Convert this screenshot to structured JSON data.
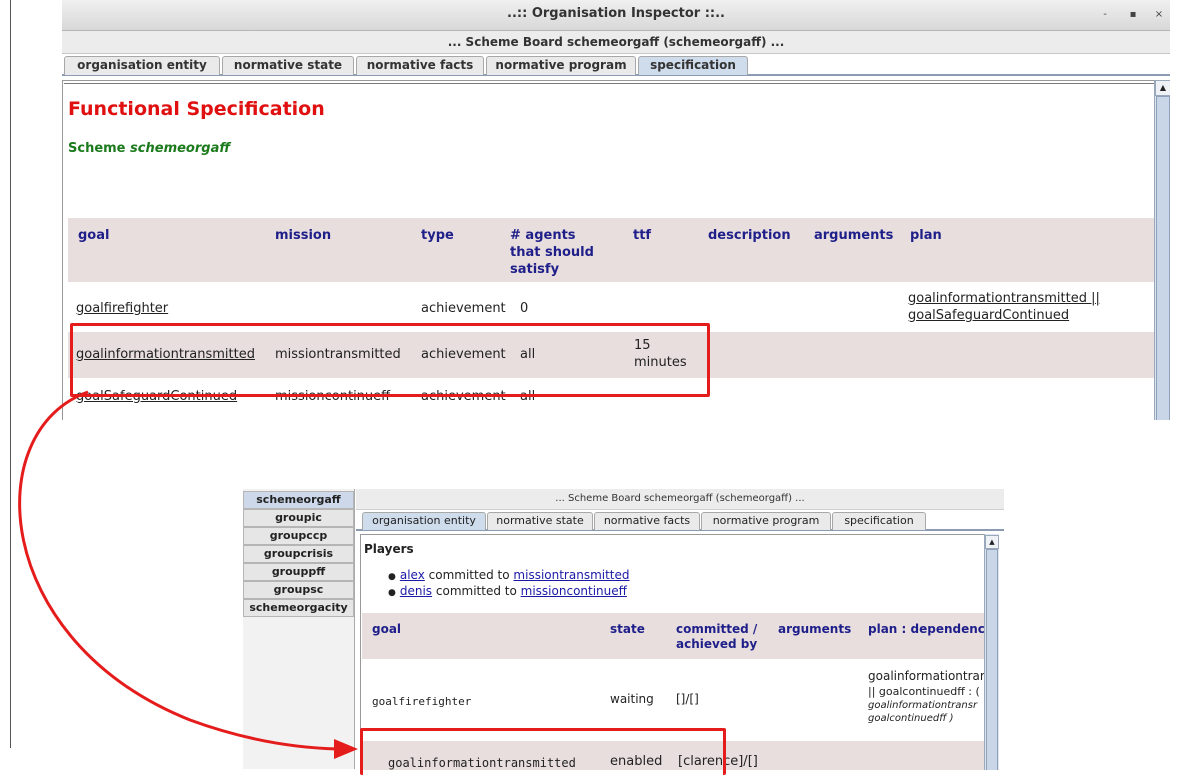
{
  "top_window": {
    "title": "..:: Organisation Inspector ::..",
    "controls": [
      "-",
      "▪",
      "×"
    ],
    "subtitle": "... Scheme Board schemeorgaff (schemeorgaff) ...",
    "tabs": [
      "organisation entity",
      "normative state",
      "normative facts",
      "normative program",
      "specification"
    ],
    "selected_tab": "specification",
    "heading": "Functional Specification",
    "scheme_prefix": "Scheme",
    "scheme_name": "schemeorgaff",
    "table": {
      "headers": {
        "goal": "goal",
        "mission": "mission",
        "type": "type",
        "agents": "# agents that should satisfy",
        "ttf": "ttf",
        "description": "description",
        "arguments": "arguments",
        "plan": "plan"
      },
      "rows": [
        {
          "goal": "goalfirefighter",
          "mission": "",
          "type": "achievement",
          "agents": "0",
          "ttf": "",
          "plan_a": "goalinformationtransmitted ||",
          "plan_b": "goalSafeguardContinued"
        },
        {
          "goal": "goalinformationtransmitted",
          "mission": "missiontransmitted",
          "type": "achievement",
          "agents": "all",
          "ttf": "15 minutes"
        },
        {
          "goal": "goalSafeguardContinued",
          "mission": "missioncontinueff",
          "type": "achievement",
          "agents": "all"
        }
      ]
    }
  },
  "bottom_window": {
    "side_list": [
      "schemeorgaff",
      "groupic",
      "groupccp",
      "groupcrisis",
      "grouppff",
      "groupsc",
      "schemeorgacity"
    ],
    "selected_side": "schemeorgaff",
    "subtitle": "... Scheme Board schemeorgaff (schemeorgaff) ...",
    "tabs": [
      "organisation entity",
      "normative state",
      "normative facts",
      "normative program",
      "specification"
    ],
    "selected_tab": "organisation entity",
    "players_label": "Players",
    "players": [
      {
        "agent": "alex",
        "text": "committed to",
        "mission": "missiontransmitted"
      },
      {
        "agent": "denis",
        "text": "committed to",
        "mission": "missioncontinueff"
      }
    ],
    "table": {
      "headers": {
        "goal": "goal",
        "state": "state",
        "committed": "committed / achieved by",
        "arguments": "arguments",
        "plan": "plan : dependenc"
      },
      "rows": [
        {
          "goal": "goalfirefighter",
          "state": "waiting",
          "committed": "[]/[]",
          "plan_line1": "goalinformationtrar",
          "plan_line2": "|| goalcontinuedff : (",
          "plan_line3": "goalinformationtransr",
          "plan_line4": "goalcontinuedff )"
        },
        {
          "goal": "goalinformationtransmitted",
          "state": "enabled",
          "committed": "[clarence]/[]"
        }
      ]
    }
  },
  "annotation_color": "#e51c1c"
}
